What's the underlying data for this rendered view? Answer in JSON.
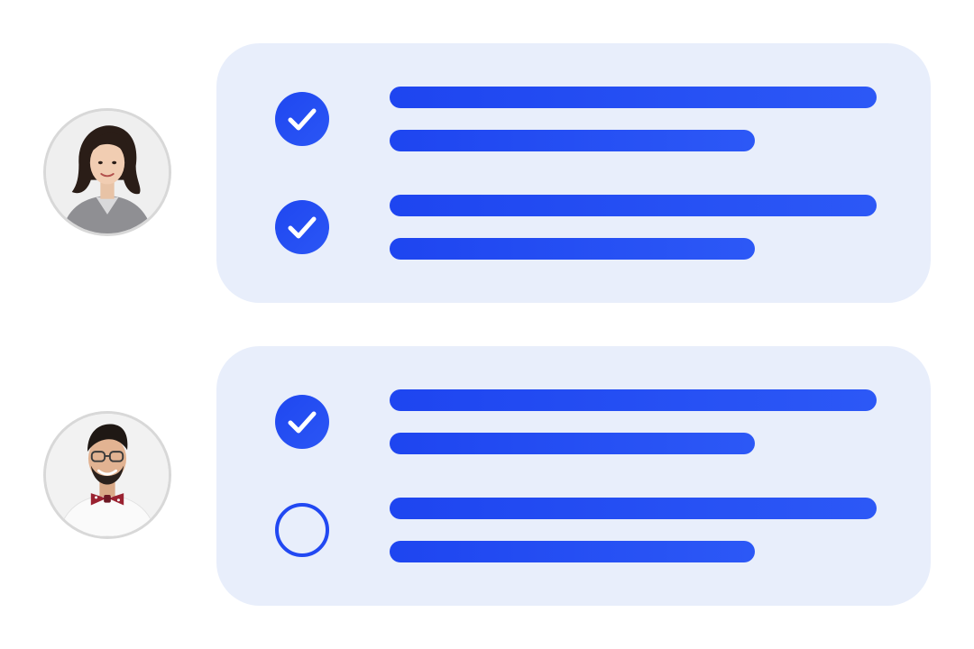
{
  "colors": {
    "accent": "#2148f2",
    "card_background": "#e8eefb",
    "avatar_border": "#d8d8d8",
    "page_background": "#ffffff"
  },
  "assignees": [
    {
      "avatar": "woman-portrait-photo",
      "tasks": [
        {
          "completed": true,
          "checkbox_icon": "check-icon"
        },
        {
          "completed": true,
          "checkbox_icon": "check-icon"
        }
      ]
    },
    {
      "avatar": "man-portrait-photo",
      "tasks": [
        {
          "completed": true,
          "checkbox_icon": "check-icon"
        },
        {
          "completed": false,
          "checkbox_icon": "empty-circle-icon"
        }
      ]
    }
  ]
}
